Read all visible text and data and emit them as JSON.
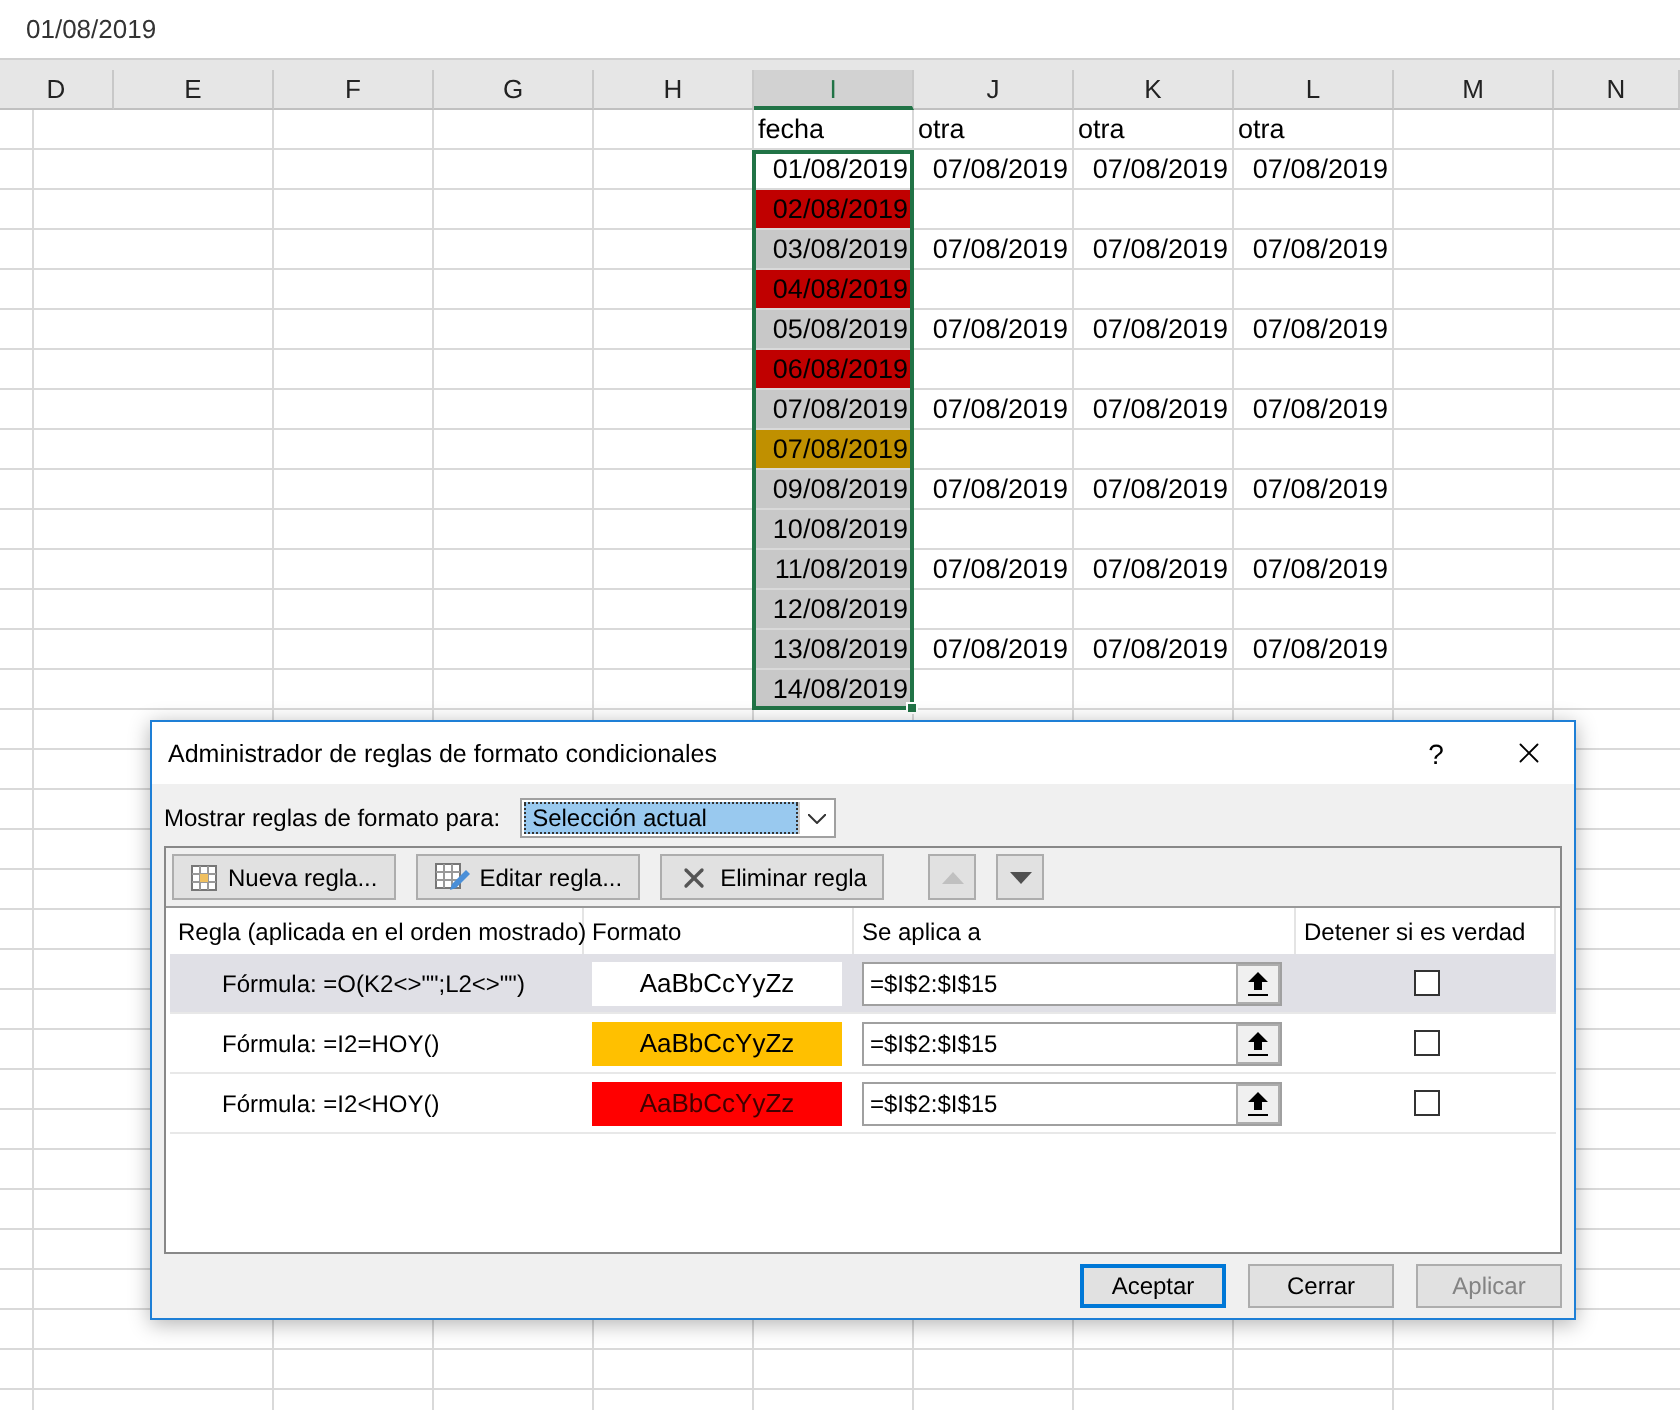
{
  "formula_bar": {
    "value": "01/08/2019"
  },
  "sheet": {
    "columns": [
      {
        "label": "D",
        "selected": false
      },
      {
        "label": "E",
        "selected": false
      },
      {
        "label": "F",
        "selected": false
      },
      {
        "label": "G",
        "selected": false
      },
      {
        "label": "H",
        "selected": false
      },
      {
        "label": "I",
        "selected": true
      },
      {
        "label": "J",
        "selected": false
      },
      {
        "label": "K",
        "selected": false
      },
      {
        "label": "L",
        "selected": false
      },
      {
        "label": "M",
        "selected": false
      },
      {
        "label": "N",
        "selected": false
      }
    ],
    "header_row": [
      "fecha",
      "otra",
      "otra",
      "otra"
    ],
    "rows": [
      {
        "date": "01/08/2019",
        "color": "#ffffff",
        "others": [
          "07/08/2019",
          "07/08/2019",
          "07/08/2019"
        ]
      },
      {
        "date": "02/08/2019",
        "color": "#c00000"
      },
      {
        "date": "03/08/2019",
        "color": "#c8c8c8",
        "others": [
          "07/08/2019",
          "07/08/2019",
          "07/08/2019"
        ]
      },
      {
        "date": "04/08/2019",
        "color": "#c00000"
      },
      {
        "date": "05/08/2019",
        "color": "#c8c8c8",
        "others": [
          "07/08/2019",
          "07/08/2019",
          "07/08/2019"
        ]
      },
      {
        "date": "06/08/2019",
        "color": "#c00000"
      },
      {
        "date": "07/08/2019",
        "color": "#c8c8c8",
        "others": [
          "07/08/2019",
          "07/08/2019",
          "07/08/2019"
        ]
      },
      {
        "date": "07/08/2019",
        "color": "#c09000"
      },
      {
        "date": "09/08/2019",
        "color": "#c8c8c8",
        "others": [
          "07/08/2019",
          "07/08/2019",
          "07/08/2019"
        ]
      },
      {
        "date": "10/08/2019",
        "color": "#c8c8c8"
      },
      {
        "date": "11/08/2019",
        "color": "#c8c8c8",
        "others": [
          "07/08/2019",
          "07/08/2019",
          "07/08/2019"
        ]
      },
      {
        "date": "12/08/2019",
        "color": "#c8c8c8"
      },
      {
        "date": "13/08/2019",
        "color": "#c8c8c8",
        "others": [
          "07/08/2019",
          "07/08/2019",
          "07/08/2019"
        ]
      },
      {
        "date": "14/08/2019",
        "color": "#c8c8c8"
      }
    ]
  },
  "dialog": {
    "title": "Administrador de reglas de formato condicionales",
    "help": "?",
    "scope_label": "Mostrar reglas de formato para:",
    "scope_value": "Selección actual",
    "toolbar": [
      {
        "kind": "new",
        "label": "Nueva regla..."
      },
      {
        "kind": "edit",
        "label": "Editar regla..."
      },
      {
        "kind": "delete",
        "label": "Eliminar regla"
      }
    ],
    "move_buttons": [
      {
        "kind": "up",
        "disabled": true
      },
      {
        "kind": "down",
        "disabled": false
      }
    ],
    "columns": [
      "Regla (aplicada en el orden mostrado)",
      "Formato",
      "Se aplica a",
      "Detener si es verdad"
    ],
    "rules": [
      {
        "rule": "Fórmula: =O(K2<>\"\";L2<>\"\")",
        "preview": "AaBbCcYyZz",
        "color": "#ffffff",
        "applies_to": "=$I$2:$I$15",
        "stop": false,
        "selected": true
      },
      {
        "rule": "Fórmula: =I2=HOY()",
        "preview": "AaBbCcYyZz",
        "color": "#ffc000",
        "applies_to": "=$I$2:$I$15",
        "stop": false,
        "selected": false
      },
      {
        "rule": "Fórmula: =I2<HOY()",
        "preview": "AaBbCcYyZz",
        "color": "#ff0000",
        "applies_to": "=$I$2:$I$15",
        "stop": false,
        "selected": false
      }
    ],
    "buttons": [
      {
        "label": "Aceptar",
        "default": true,
        "disabled": false
      },
      {
        "label": "Cerrar",
        "default": false,
        "disabled": false
      },
      {
        "label": "Aplicar",
        "default": false,
        "disabled": true
      }
    ]
  }
}
